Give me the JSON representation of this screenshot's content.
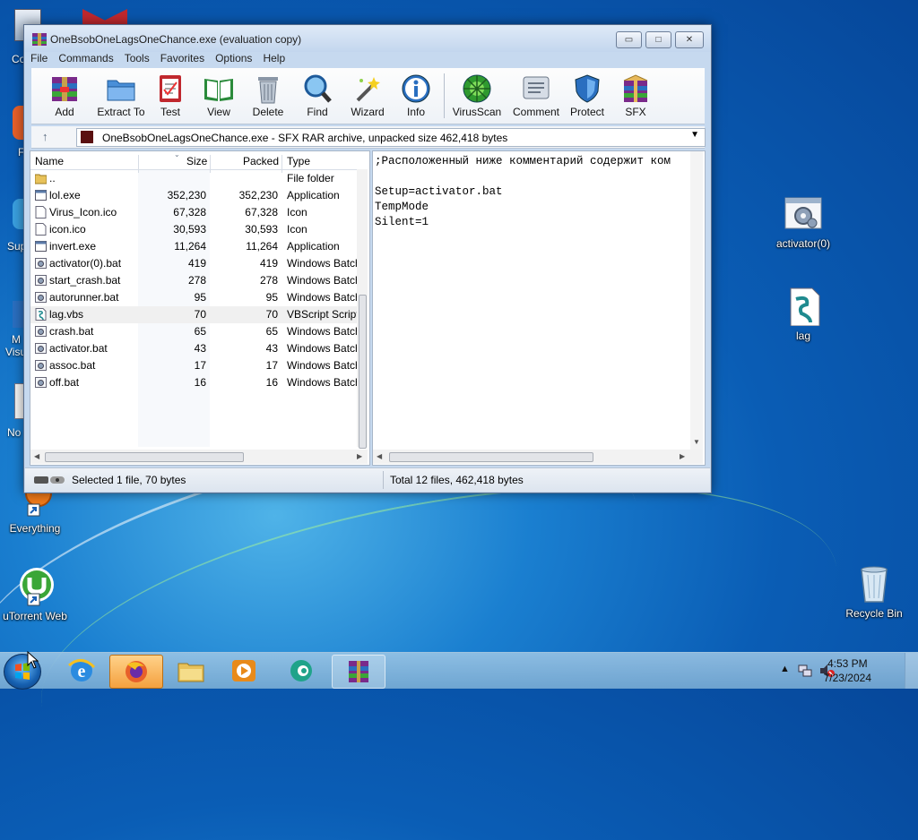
{
  "window": {
    "title": "OneBsobOneLagsOneChance.exe (evaluation copy)",
    "controls": {
      "minimize": "▭",
      "maximize": "□",
      "close": "✕"
    }
  },
  "menu": [
    "File",
    "Commands",
    "Tools",
    "Favorites",
    "Options",
    "Help"
  ],
  "toolbar": [
    "Add",
    "Extract To",
    "Test",
    "View",
    "Delete",
    "Find",
    "Wizard",
    "Info",
    "VirusScan",
    "Comment",
    "Protect",
    "SFX"
  ],
  "address": {
    "text": "OneBsobOneLagsOneChance.exe - SFX RAR archive, unpacked size 462,418 bytes"
  },
  "columns": {
    "name": "Name",
    "size": "Size",
    "packed": "Packed",
    "type": "Type"
  },
  "files": [
    {
      "name": "..",
      "size": "",
      "packed": "",
      "type": "File folder",
      "icon": "folder-icon"
    },
    {
      "name": "lol.exe",
      "size": "352,230",
      "packed": "352,230",
      "type": "Application",
      "icon": "exe-icon"
    },
    {
      "name": "Virus_Icon.ico",
      "size": "67,328",
      "packed": "67,328",
      "type": "Icon",
      "icon": "file-icon"
    },
    {
      "name": "icon.ico",
      "size": "30,593",
      "packed": "30,593",
      "type": "Icon",
      "icon": "file-icon"
    },
    {
      "name": "invert.exe",
      "size": "11,264",
      "packed": "11,264",
      "type": "Application",
      "icon": "exe-icon"
    },
    {
      "name": "activator(0).bat",
      "size": "419",
      "packed": "419",
      "type": "Windows Batch F",
      "icon": "bat-icon"
    },
    {
      "name": "start_crash.bat",
      "size": "278",
      "packed": "278",
      "type": "Windows Batch",
      "icon": "bat-icon"
    },
    {
      "name": "autorunner.bat",
      "size": "95",
      "packed": "95",
      "type": "Windows Batch",
      "icon": "bat-icon"
    },
    {
      "name": "lag.vbs",
      "size": "70",
      "packed": "70",
      "type": "VBScript Script",
      "icon": "vbs-icon",
      "selected": true
    },
    {
      "name": "crash.bat",
      "size": "65",
      "packed": "65",
      "type": "Windows Batch",
      "icon": "bat-icon"
    },
    {
      "name": "activator.bat",
      "size": "43",
      "packed": "43",
      "type": "Windows Batch",
      "icon": "bat-icon"
    },
    {
      "name": "assoc.bat",
      "size": "17",
      "packed": "17",
      "type": "Windows Batch",
      "icon": "bat-icon"
    },
    {
      "name": "off.bat",
      "size": "16",
      "packed": "16",
      "type": "Windows Batch",
      "icon": "bat-icon"
    }
  ],
  "comment": {
    "lines": [
      ";Расположенный ниже комментарий содержит ком",
      "",
      "Setup=activator.bat",
      "TempMode",
      "Silent=1"
    ]
  },
  "status": {
    "left": "Selected 1 file, 70 bytes",
    "right": "Total 12 files, 462,418 bytes"
  },
  "desktop": {
    "icons": [
      {
        "label": "activator(0)",
        "icon": "bat-icon"
      },
      {
        "label": "lag",
        "icon": "vbs-icon"
      },
      {
        "label": "Everything",
        "icon": "everything-icon"
      },
      {
        "label": "uTorrent Web",
        "icon": "utorrent-icon"
      },
      {
        "label": "Recycle Bin",
        "icon": "recycle-bin-icon"
      }
    ],
    "partial": [
      "Co",
      "F",
      "Sup",
      "M",
      "Visu",
      "No"
    ]
  },
  "taskbar": {
    "items": [
      "internet-explorer-icon",
      "firefox-icon",
      "file-explorer-icon",
      "media-player-icon",
      "browser-icon",
      "winrar-icon"
    ],
    "clock": {
      "time": "4:53 PM",
      "date": "7/23/2024"
    },
    "tray": {
      "arrow": "▲"
    }
  }
}
